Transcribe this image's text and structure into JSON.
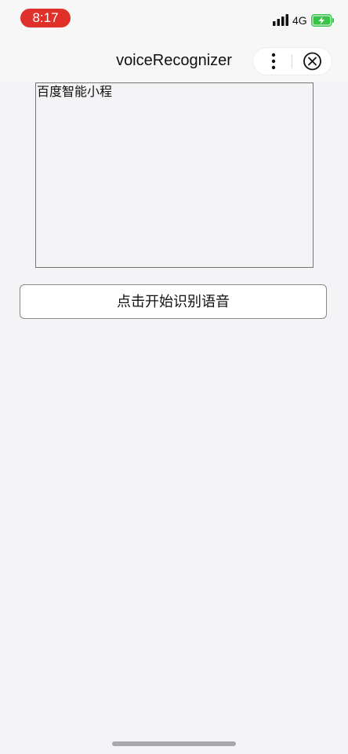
{
  "status_bar": {
    "time": "8:17",
    "network": "4G",
    "icons": [
      "cellular-signal-icon",
      "battery-charging-icon"
    ],
    "time_pill_color": "#e0302a",
    "battery_color": "#3ac24a"
  },
  "nav_bar": {
    "title": "voiceRecognizer",
    "icons": [
      "more-icon",
      "close-circle-icon"
    ]
  },
  "content": {
    "text_area_value": "百度智能小程",
    "start_button_label": "点击开始识别语音"
  }
}
